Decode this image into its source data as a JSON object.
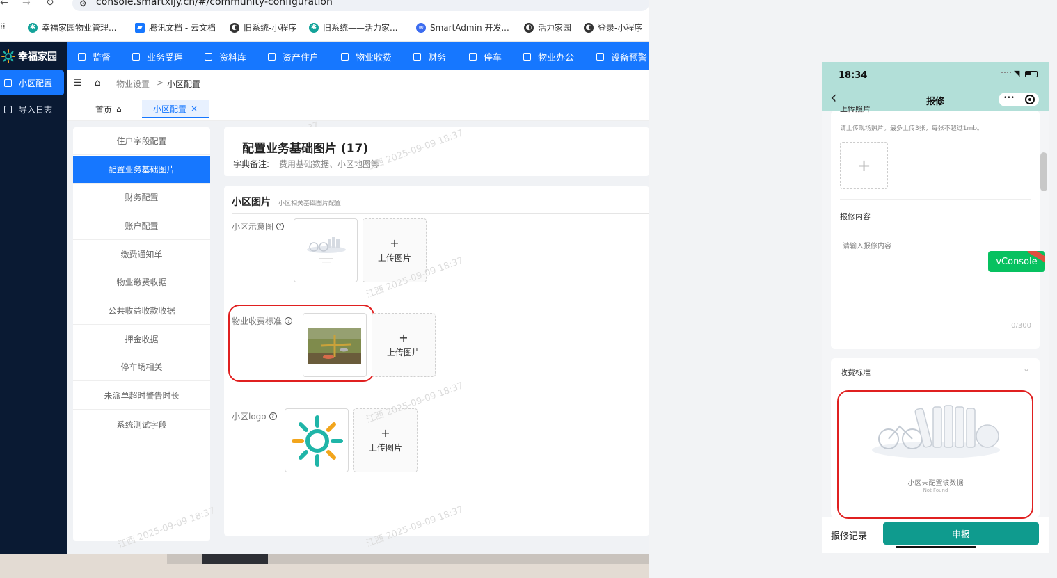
{
  "browser": {
    "url": "console.smartxijy.cn/#/community-configuration",
    "bookmarks": [
      {
        "label": "幸福家园物业管理...",
        "color": "#14a39a"
      },
      {
        "label": "腾讯文档 - 云文档",
        "color": "#1677ff"
      },
      {
        "label": "旧系统-小程序",
        "color": "#333333"
      },
      {
        "label": "旧系统——活力家...",
        "color": "#14a39a"
      },
      {
        "label": "SmartAdmin 开发...",
        "color": "#3c6cf0"
      },
      {
        "label": "活力家园",
        "color": "#333333"
      },
      {
        "label": "登录-小程序",
        "color": "#333333"
      }
    ]
  },
  "app": {
    "logo_text": "幸福家园",
    "top_nav": [
      "监督",
      "业务受理",
      "资料库",
      "资产住户",
      "物业收费",
      "财务",
      "停车",
      "物业办公",
      "设备预警"
    ],
    "side_nav": [
      {
        "label": "小区配置",
        "active": true
      },
      {
        "label": "导入日志",
        "active": false
      }
    ],
    "breadcrumb": {
      "parent": "物业设置",
      "separator": ">",
      "current": "小区配置"
    },
    "tabs": {
      "home": "首页",
      "active": "小区配置",
      "close": "×"
    },
    "left_menu": [
      {
        "label": "住户字段配置",
        "active": false
      },
      {
        "label": "配置业务基础图片",
        "active": true
      },
      {
        "label": "财务配置",
        "active": false
      },
      {
        "label": "账户配置",
        "active": false
      },
      {
        "label": "缴费通知单",
        "active": false
      },
      {
        "label": "物业缴费收据",
        "active": false
      },
      {
        "label": "公共收益收款收据",
        "active": false
      },
      {
        "label": "押金收据",
        "active": false
      },
      {
        "label": "停车场相关",
        "active": false
      },
      {
        "label": "未派单超时警告时长",
        "active": false
      },
      {
        "label": "系统测试字段",
        "active": false
      }
    ],
    "panel": {
      "title": "配置业务基础图片 (17)",
      "remark_label": "字典备注:",
      "remark_value": "费用基础数据、小区地图等",
      "section_title": "小区图片",
      "section_sub": "小区相关基础图片配置",
      "fields": [
        {
          "label": "小区示意图",
          "upload_label": "上传图片"
        },
        {
          "label": "物业收费标准",
          "upload_label": "上传图片"
        },
        {
          "label": "小区logo",
          "upload_label": "上传图片"
        }
      ]
    },
    "watermark": "江西 2025-09-09 18:37",
    "upload_plus": "+",
    "help_glyph": "?"
  },
  "phone": {
    "time": "18:34",
    "title": "报修",
    "back_glyph": "‹",
    "menu_glyph": "•••",
    "photo_label_partial": "上传照片",
    "photo_hint": "请上传现场照片。最多上传3张，每张不超过1mb。",
    "content_label": "报修内容",
    "content_placeholder": "请输入报修内容",
    "counter": "0/300",
    "vconsole": "vConsole",
    "fee_label": "收费标准",
    "empty_text": "小区未配置该数据",
    "empty_sub": "Not Found",
    "records_button": "报修记录",
    "submit_button": "申报"
  },
  "colors": {
    "primary": "#1677ff",
    "sidebar_dark": "#0a1a33",
    "phone_header": "#b2dfd8",
    "phone_submit": "#0f9b8e",
    "highlight_red": "#e02020",
    "vconsole_green": "#07c160"
  }
}
